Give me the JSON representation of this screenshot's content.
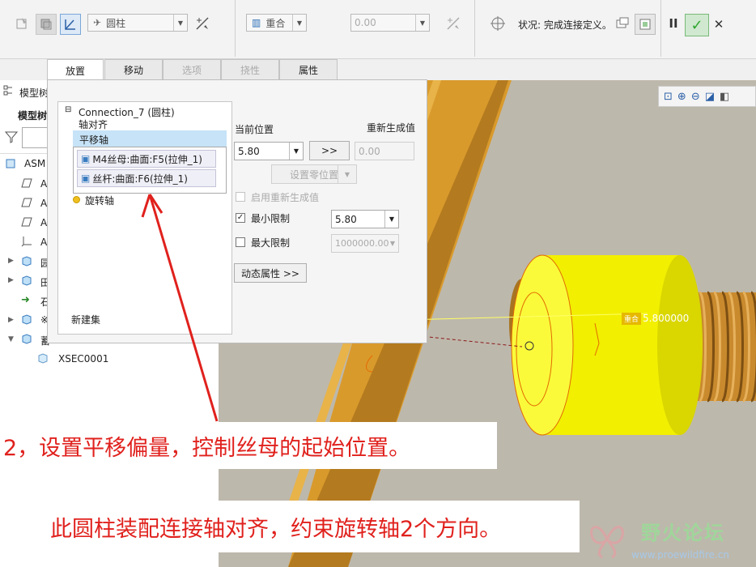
{
  "ribbon": {
    "connection_type": "圆柱",
    "constraint_type": "重合",
    "offset_value": "0.00",
    "status_text": "状况: 完成连接定义。",
    "pause_label": "II",
    "ok_label": "✓",
    "cancel_label": "✕"
  },
  "tabs": [
    {
      "label": "放置",
      "state": "active"
    },
    {
      "label": "移动",
      "state": "normal"
    },
    {
      "label": "选项",
      "state": "disabled"
    },
    {
      "label": "挠性",
      "state": "disabled"
    },
    {
      "label": "属性",
      "state": "normal"
    }
  ],
  "model_tree": {
    "header_title": "模型树",
    "subheader": "模型树",
    "root": "ASM",
    "items": [
      "A",
      "A",
      "A",
      "A",
      "园",
      "田",
      "石",
      "※",
      "蓄",
      "XSEC0001"
    ]
  },
  "placement_panel": {
    "connection_name": "Connection_7 (圆柱)",
    "axis_align": "轴对齐",
    "translation_axis": "平移轴",
    "ref_1": "M4丝母:曲面:F5(拉伸_1)",
    "ref_2": "丝杆:曲面:F6(拉伸_1)",
    "rotation_axis": "旋转轴",
    "new_set": "新建集",
    "current_position_label": "当前位置",
    "current_position_value": "5.80",
    "go_button": ">>",
    "regen_label": "重新生成值",
    "regen_value": "0.00",
    "set_zero_button": "设置零位置",
    "enable_regen_label": "启用重新生成值",
    "min_limit_label": "最小限制",
    "min_limit_value": "5.80",
    "max_limit_label": "最大限制",
    "max_limit_value": "1000000.00",
    "dynamic_props_button": "动态属性 >>"
  },
  "graphics": {
    "dimension_tag": "重合",
    "dimension_value": "5.800000"
  },
  "annotations": {
    "step_text": "2，设置平移偏量，控制丝母的起始位置。",
    "note_text": "此圆柱装配连接轴对齐，约束旋转轴2个方向。"
  },
  "watermark": {
    "title": "野火论坛",
    "url": "www.proewildfire.cn"
  },
  "colors": {
    "annotation_red": "#e0211d",
    "selection_blue": "#c7e3f7",
    "ok_green": "#2fa62f",
    "nut_yellow": "#f2ef00",
    "screw_brown": "#c98a2e",
    "plate_orange": "#d99a2c"
  }
}
